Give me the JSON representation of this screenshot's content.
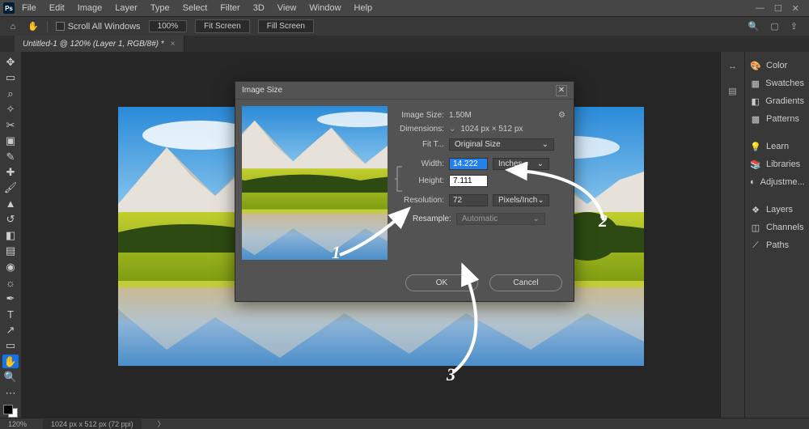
{
  "menu": {
    "items": [
      "File",
      "Edit",
      "Image",
      "Layer",
      "Type",
      "Select",
      "Filter",
      "3D",
      "View",
      "Window",
      "Help"
    ]
  },
  "options": {
    "scroll_label": "Scroll All Windows",
    "zoom": "100%",
    "fit_screen": "Fit Screen",
    "fill_screen": "Fill Screen"
  },
  "doc_tab": {
    "title": "Untitled-1 @ 120% (Layer 1, RGB/8#) *"
  },
  "right_panels": {
    "items": [
      "Color",
      "Swatches",
      "Gradients",
      "Patterns",
      "Learn",
      "Libraries",
      "Adjustme...",
      "Layers",
      "Channels",
      "Paths"
    ]
  },
  "dialog": {
    "title": "Image Size",
    "image_size_lbl": "Image Size:",
    "image_size_val": "1.50M",
    "dimensions_lbl": "Dimensions:",
    "dimensions_val": "1024 px × 512 px",
    "fit_to_lbl": "Fit T...",
    "fit_to_val": "Original Size",
    "width_lbl": "Width:",
    "width_val": "14.222",
    "width_unit": "Inches",
    "height_lbl": "Height:",
    "height_val": "7.111",
    "resolution_lbl": "Resolution:",
    "resolution_val": "72",
    "resolution_unit": "Pixels/Inch",
    "resample_lbl": "Resample:",
    "resample_mode": "Automatic",
    "ok": "OK",
    "cancel": "Cancel"
  },
  "status": {
    "zoom": "120%",
    "docinfo": "1024 px x 512 px (72 ppi)"
  },
  "annotations": {
    "a1": "1",
    "a2": "2",
    "a3": "3"
  }
}
